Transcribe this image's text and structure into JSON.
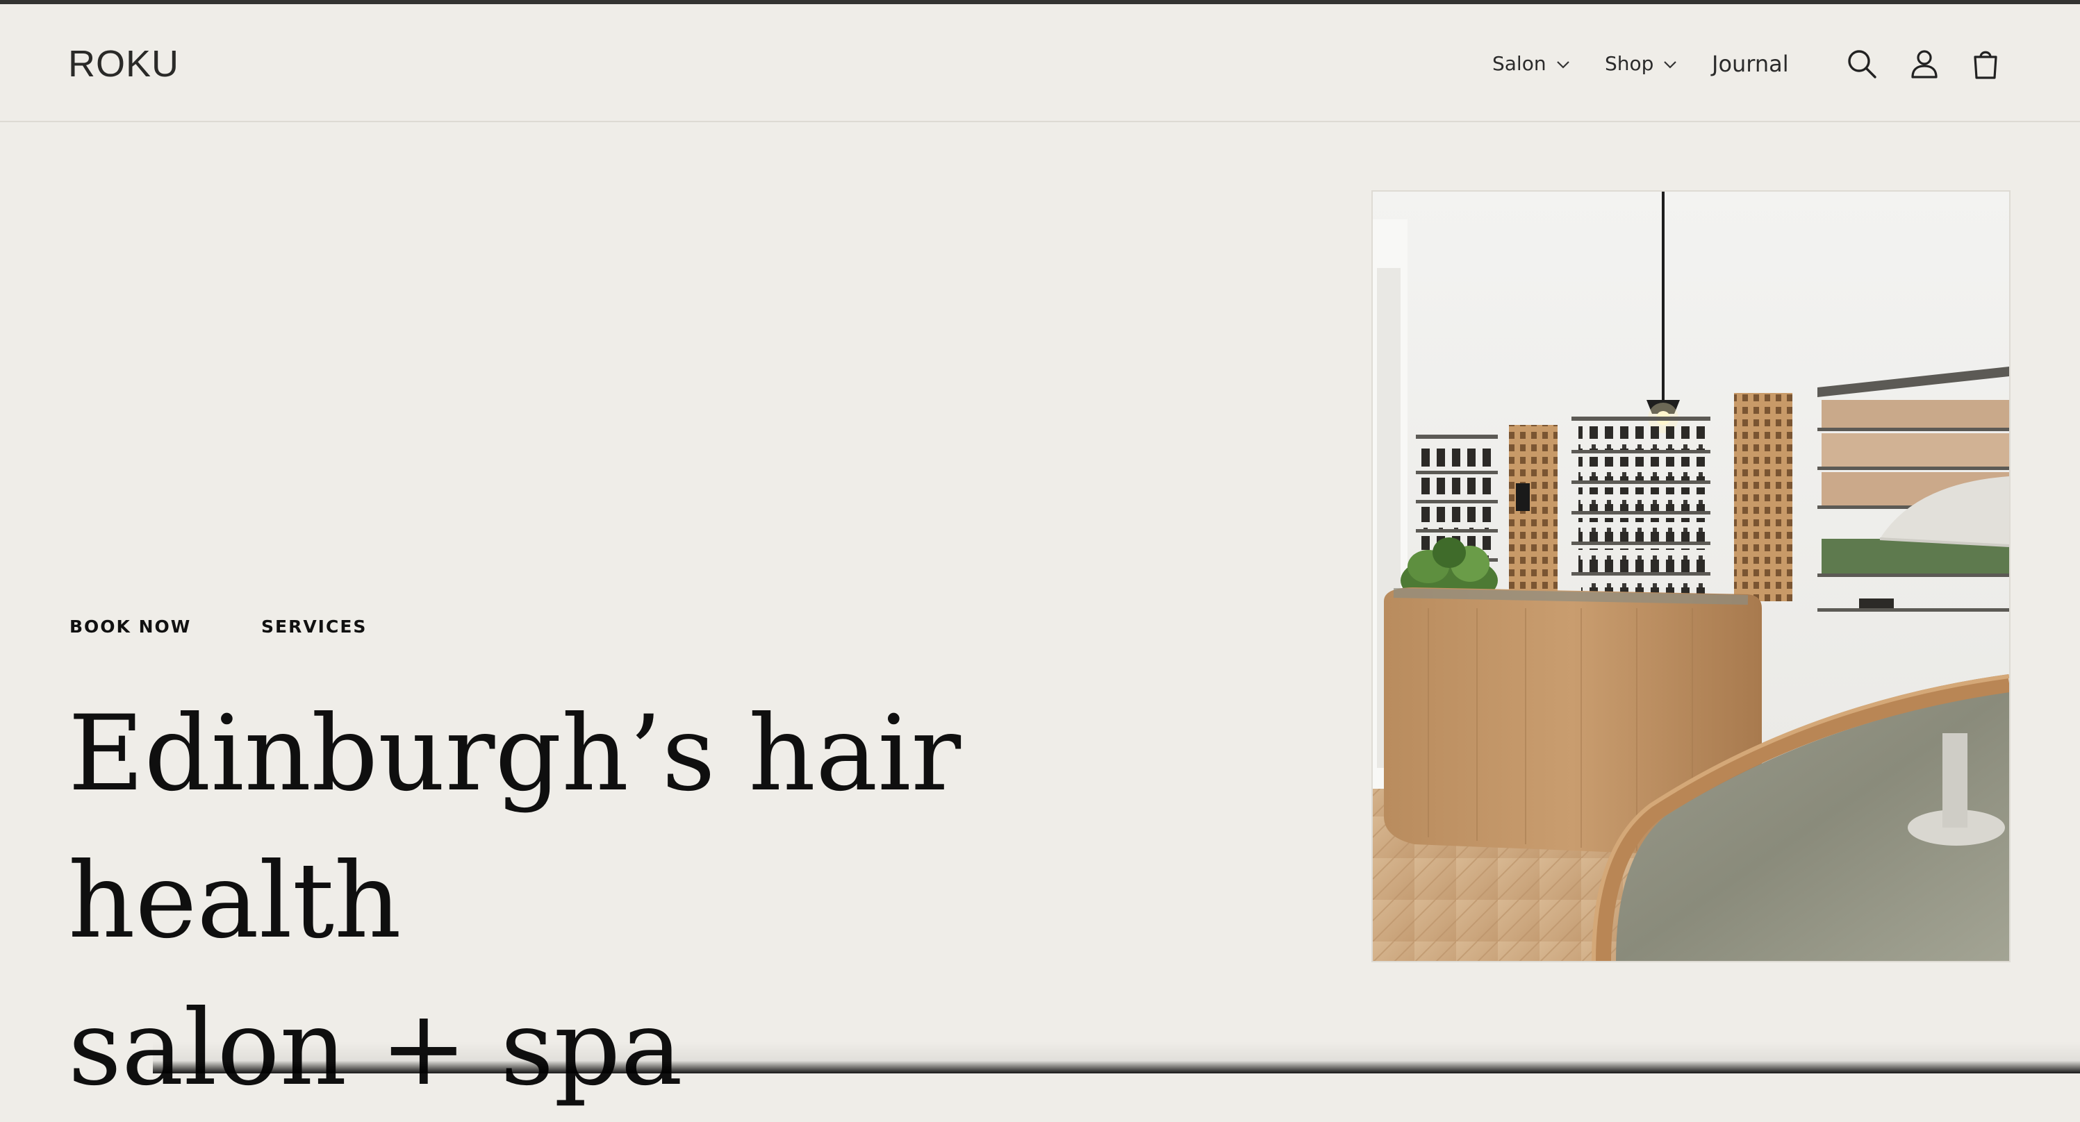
{
  "header": {
    "logo": "ROKU",
    "nav": [
      {
        "label": "Salon"
      },
      {
        "label": "Shop"
      },
      {
        "label": "Journal"
      }
    ],
    "icons": [
      "search-icon",
      "account-icon",
      "cart-icon"
    ]
  },
  "hero": {
    "links": {
      "book": "BOOK NOW",
      "services": "SERVICES"
    },
    "title_line1": "Edinburgh’s hair health",
    "title_line2": "salon + spa",
    "image": "salon interior with wooden counter and product shelves"
  },
  "colors": {
    "background": "#efede8",
    "text": "#111111",
    "top_strip": "#333331"
  }
}
